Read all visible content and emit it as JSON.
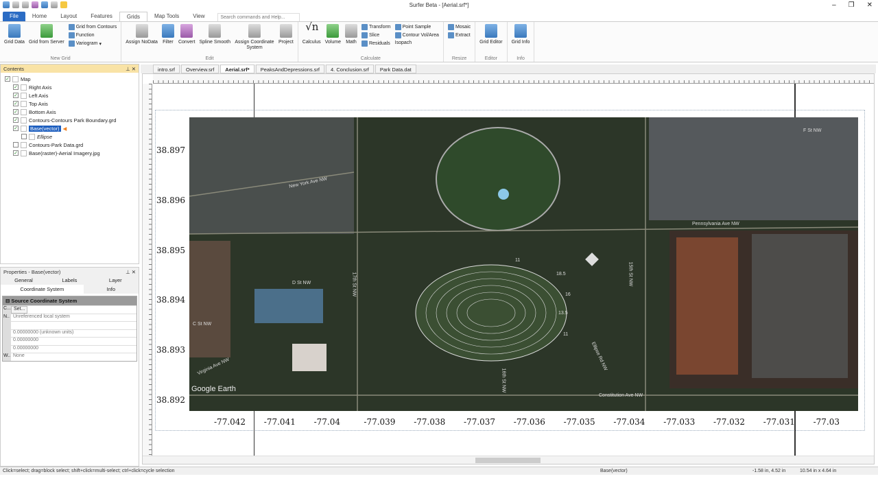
{
  "window": {
    "title": "Surfer Beta - [Aerial.srf*]"
  },
  "ribbon_tabs": [
    "File",
    "Home",
    "Layout",
    "Features",
    "Grids",
    "Map Tools",
    "View"
  ],
  "search_placeholder": "Search commands and Help...",
  "groups": {
    "new_grid": {
      "label": "New Grid",
      "big": [
        "Grid Data",
        "Grid from Server"
      ],
      "small": [
        "Grid from Contours",
        "Function",
        "Variogram"
      ]
    },
    "edit": {
      "label": "Edit",
      "big": [
        "Assign NoData",
        "Filter",
        "Convert",
        "Spline Smooth",
        "Assign Coordinate System",
        "Project"
      ]
    },
    "calculate": {
      "label": "Calculate",
      "big": [
        "Calculus",
        "Volume",
        "Math"
      ],
      "small": [
        "Transform",
        "Slice",
        "Residuals",
        "Point Sample",
        "Contour Vol/Area",
        "Isopach"
      ]
    },
    "resize": {
      "label": "Resize",
      "small": [
        "Mosaic",
        "Extract"
      ]
    },
    "editor": {
      "label": "Editor",
      "big": [
        "Grid Editor"
      ]
    },
    "info": {
      "label": "Info",
      "big": [
        "Grid Info"
      ]
    }
  },
  "contents": {
    "title": "Contents",
    "items": [
      {
        "label": "Map",
        "checked": true,
        "level": 0
      },
      {
        "label": "Right Axis",
        "checked": true,
        "level": 1
      },
      {
        "label": "Left Axis",
        "checked": true,
        "level": 1
      },
      {
        "label": "Top Axis",
        "checked": true,
        "level": 1
      },
      {
        "label": "Bottom Axis",
        "checked": true,
        "level": 1
      },
      {
        "label": "Contours-Contours Park Boundary.grd",
        "checked": true,
        "level": 1
      },
      {
        "label": "Base(vector)",
        "checked": true,
        "level": 1,
        "selected": true
      },
      {
        "label": "Ellipse",
        "checked": false,
        "level": 2
      },
      {
        "label": "Contours-Park Data.grd",
        "checked": false,
        "level": 1
      },
      {
        "label": "Base(raster)-Aerial Imagery.jpg",
        "checked": true,
        "level": 1
      }
    ]
  },
  "properties": {
    "title": "Properties - Base(vector)",
    "tabs": [
      "General",
      "Labels",
      "Layer",
      "Coordinate System",
      "Info"
    ],
    "section": "Source Coordinate System",
    "rows": [
      {
        "k": "C...",
        "v": "Set..."
      },
      {
        "k": "N..",
        "v": "Unreferenced local system"
      },
      {
        "k": "",
        "v": ""
      },
      {
        "k": "",
        "v": "0.00000000 (unknown units)"
      },
      {
        "k": "",
        "v": "0.00000000"
      },
      {
        "k": "",
        "v": "0.00000000"
      },
      {
        "k": "W..",
        "v": "None"
      }
    ]
  },
  "doc_tabs": [
    "intro.srf",
    "Overview.srf",
    "Aerial.srf*",
    "PeaksAndDepressions.srf",
    "4. Conclusion.srf",
    "Park Data.dat"
  ],
  "y_labels": [
    "38.897",
    "38.896",
    "38.895",
    "38.894",
    "38.893",
    "38.892"
  ],
  "x_labels": [
    "-77.042",
    "-77.041",
    "-77.04",
    "-77.039",
    "-77.038",
    "-77.037",
    "-77.036",
    "-77.035",
    "-77.034",
    "-77.033",
    "-77.032",
    "-77.031",
    "-77.03"
  ],
  "streets": [
    "New York Ave NW",
    "D St NW",
    "C St NW",
    "Virginia Ave NW",
    "F St NW",
    "Pennsylvania Ave NW",
    "15th St NW",
    "17th St NW",
    "Constitution Ave NW",
    "Ellipse Rd NW",
    "16th St NW"
  ],
  "contour_labels": [
    "11",
    "18.5",
    "16",
    "13.5",
    "11"
  ],
  "watermark": "Google Earth",
  "status": {
    "hint": "Click=select; drag=block select; shift+click=multi-select; ctrl+click=cycle selection",
    "object": "Base(vector)",
    "position": "-1.58 in, 4.52 in",
    "size": "10.54 in x 4.64 in"
  }
}
